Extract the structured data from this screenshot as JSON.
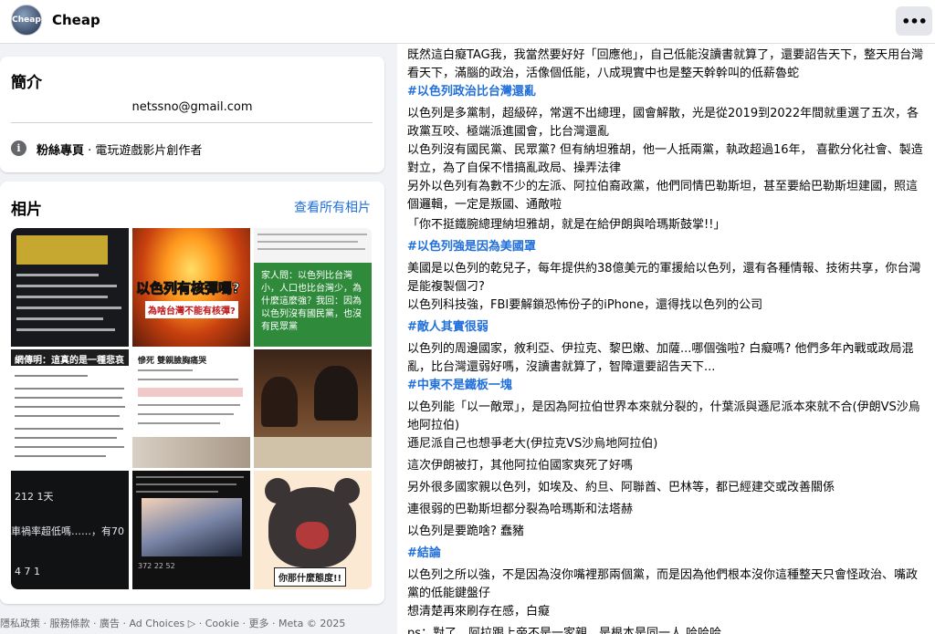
{
  "header": {
    "avatar_text": "Cheap",
    "page_name": "Cheap",
    "more_label": "•••"
  },
  "intro": {
    "title": "簡介",
    "email": "netssno@gmail.com",
    "category_label": "粉絲專頁",
    "category_value": " · 電玩遊戲影片創作者"
  },
  "photos": {
    "title": "相片",
    "see_all": "查看所有相片",
    "thumbs": {
      "t2_title": "以色列有核彈嗎?",
      "t2_sub": "為啥台灣不能有核彈?",
      "t3_text": "家人問：以色列比台灣小，人口也比台灣少，為什麼這麼強？我回：因為以色列沒有國民黨，也沒有民眾黨",
      "t4_title": "網傳明：這真的是一種悲哀",
      "t5_title": "慘死 雙親臉胸痛哭",
      "t7_a": "212 1天",
      "t7_b": "車禍率超低嗎……，有70",
      "t7_c": "4   7 1",
      "t8_footer": "372   22   52",
      "t9_caption": "你那什麼態度!!"
    }
  },
  "footer": {
    "text": "隱私政策 · 服務條款 · 廣告 · Ad Choices ▷ · Cookie · 更多 · Meta © 2025"
  },
  "post": {
    "lines": [
      {
        "text": "既然這白癡TAG我，我當然要好好「回應他」，自己低能沒讀書就算了，還要詔告天下，整天用台灣看天下，滿腦的政治，活像個低能，八成現實中也是整天幹幹叫的低薪魯蛇"
      },
      {
        "text": "#以色列政治比台灣還亂",
        "tag": true
      },
      {
        "text": "以色列是多黨制，超級碎，常選不出總理，國會解散，光是從2019到2022年間就重選了五次，各政黨互咬、極端派進國會，比台灣還亂"
      },
      {
        "text": "以色列沒有國民黨、民眾黨? 但有納坦雅胡，他一人抵兩黨，執政超過16年， 喜歡分化社會、製造對立，為了自保不惜搞亂政局、操弄法律"
      },
      {
        "text": "另外以色列有為數不少的左派、阿拉伯裔政黨，他們同情巴勒斯坦，甚至要給巴勒斯坦建國，照這個邏輯，一定是叛國、通敵啦"
      },
      {
        "text": "「你不挺鐵腕總理納坦雅胡，就是在給伊朗與哈瑪斯鼓掌!!」"
      },
      {
        "text": "#以色列強是因為美國罩",
        "tag": true
      },
      {
        "text": "美國是以色列的乾兒子，每年提供約38億美元的軍援給以色列，還有各種情報、技術共享，你台灣是能複製個刁?"
      },
      {
        "text": "以色列科技強，FBI要解鎖恐怖份子的iPhone，還得找以色列的公司"
      },
      {
        "text": "#敵人其實很弱",
        "tag": true
      },
      {
        "text": "以色列的周邊國家，敘利亞、伊拉克、黎巴嫩、加薩...哪個強啦? 白癡嗎? 他們多年內戰或政局混亂，比台灣還弱好嗎，沒讀書就算了，智障還要詔告天下..."
      },
      {
        "text": "#中東不是鐵板一塊",
        "tag": true
      },
      {
        "text": "以色列能「以一敵眾」，是因為阿拉伯世界本來就分裂的，什葉派與遜尼派本來就不合(伊朗VS沙烏地阿拉伯)"
      },
      {
        "text": "遜尼派自己也想爭老大(伊拉克VS沙烏地阿拉伯)"
      },
      {
        "text": "這次伊朗被打，其他阿拉伯國家爽死了好嗎"
      },
      {
        "text": "另外很多國家親以色列，如埃及、約旦、阿聯酋、巴林等，都已經建交或改善關係"
      },
      {
        "text": "連很弱的巴勒斯坦都分裂為哈瑪斯和法塔赫"
      },
      {
        "text": "以色列是要跪啥? 蠢豬"
      },
      {
        "text": "#結論",
        "tag": true
      },
      {
        "text": "以色列之所以強，不是因為沒你嘴裡那兩個黨，而是因為他們根本沒你這種整天只會怪政治、嘴政黨的低能鍵盤仔"
      },
      {
        "text": "想清楚再來刷存在感，白癡"
      },
      {
        "text": "ps：對了，阿拉跟上帝不是一家親，是根本是同一人 哈哈哈"
      }
    ]
  },
  "colors": {
    "link": "#216fdb",
    "page_bg": "#f0f2f5",
    "card_bg": "#ffffff"
  }
}
